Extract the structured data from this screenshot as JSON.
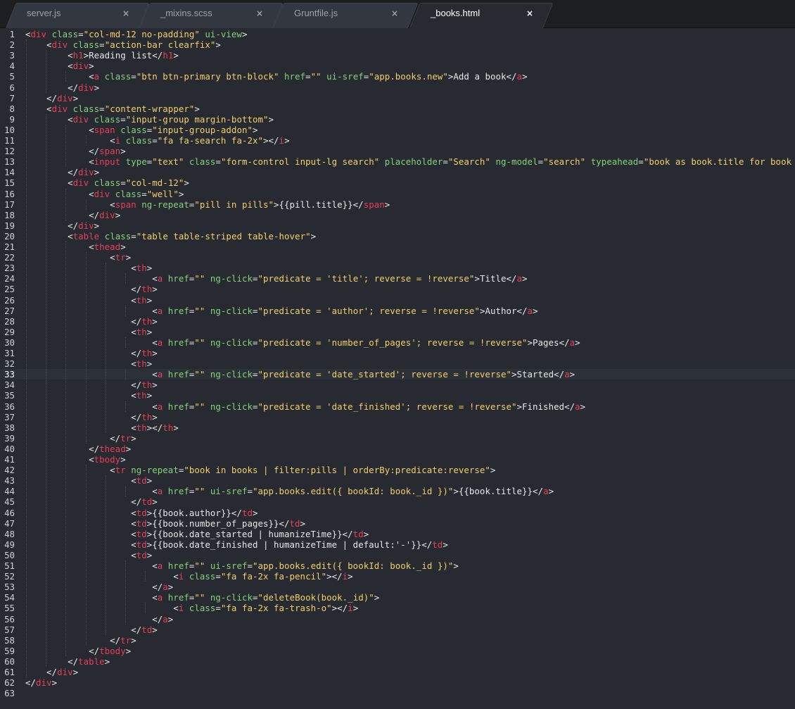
{
  "tabs": [
    {
      "label": "server.js",
      "active": false
    },
    {
      "label": "_mixins.scss",
      "active": false
    },
    {
      "label": "Gruntfile.js",
      "active": false
    },
    {
      "label": "_books.html",
      "active": true
    }
  ],
  "tab_close_glyph": "×",
  "editor": {
    "current_line": 33,
    "colors": {
      "tag": "#e83e5c",
      "attribute": "#84d27c",
      "string": "#f2d16b",
      "text": "#e8e8e8",
      "background": "#272a31"
    },
    "lines": [
      {
        "n": "1",
        "code": "<div class=\"col-md-12 no-padding\" ui-view>"
      },
      {
        "n": "2",
        "code": "    <div class=\"action-bar clearfix\">"
      },
      {
        "n": "3",
        "code": "        <h1>Reading list</h1>"
      },
      {
        "n": "4",
        "code": "        <div>"
      },
      {
        "n": "5",
        "code": "            <a class=\"btn btn-primary btn-block\" href=\"\" ui-sref=\"app.books.new\">Add a book</a>"
      },
      {
        "n": "6",
        "code": "        </div>"
      },
      {
        "n": "7",
        "code": "    </div>"
      },
      {
        "n": "8",
        "code": "    <div class=\"content-wrapper\">"
      },
      {
        "n": "9",
        "code": "        <div class=\"input-group margin-bottom\">"
      },
      {
        "n": "10",
        "code": "            <span class=\"input-group-addon\">"
      },
      {
        "n": "11",
        "code": "                <i class=\"fa fa-search fa-2x\"></i>"
      },
      {
        "n": "12",
        "code": "            </span>"
      },
      {
        "n": "13",
        "code": "            <input type=\"text\" class=\"form-control input-lg search\" placeholder=\"Search\" ng-model=\"search\" typeahead=\"book as book.title for book in books |"
      },
      {
        "n": "14",
        "code": "        </div>"
      },
      {
        "n": "15",
        "code": "        <div class=\"col-md-12\">"
      },
      {
        "n": "16",
        "code": "            <div class=\"well\">"
      },
      {
        "n": "17",
        "code": "                <span ng-repeat=\"pill in pills\">{{pill.title}}</span>"
      },
      {
        "n": "18",
        "code": "            </div>"
      },
      {
        "n": "19",
        "code": "        </div>"
      },
      {
        "n": "20",
        "code": "        <table class=\"table table-striped table-hover\">"
      },
      {
        "n": "21",
        "code": "            <thead>"
      },
      {
        "n": "22",
        "code": "                <tr>"
      },
      {
        "n": "23",
        "code": "                    <th>"
      },
      {
        "n": "24",
        "code": "                        <a href=\"\" ng-click=\"predicate = 'title'; reverse = !reverse\">Title</a>"
      },
      {
        "n": "25",
        "code": "                    </th>"
      },
      {
        "n": "26",
        "code": "                    <th>"
      },
      {
        "n": "27",
        "code": "                        <a href=\"\" ng-click=\"predicate = 'author'; reverse = !reverse\">Author</a>"
      },
      {
        "n": "28",
        "code": "                    </th>"
      },
      {
        "n": "29",
        "code": "                    <th>"
      },
      {
        "n": "30",
        "code": "                        <a href=\"\" ng-click=\"predicate = 'number_of_pages'; reverse = !reverse\">Pages</a>"
      },
      {
        "n": "31",
        "code": "                    </th>"
      },
      {
        "n": "32",
        "code": "                    <th>"
      },
      {
        "n": "33",
        "code": "                        <a href=\"\" ng-click=\"predicate = 'date_started'; reverse = !reverse\">Started</a>"
      },
      {
        "n": "34",
        "code": "                    </th>"
      },
      {
        "n": "35",
        "code": "                    <th>"
      },
      {
        "n": "36",
        "code": "                        <a href=\"\" ng-click=\"predicate = 'date_finished'; reverse = !reverse\">Finished</a>"
      },
      {
        "n": "37",
        "code": "                    </th>"
      },
      {
        "n": "38",
        "code": "                    <th></th>"
      },
      {
        "n": "39",
        "code": "                </tr>"
      },
      {
        "n": "40",
        "code": "            </thead>"
      },
      {
        "n": "41",
        "code": "            <tbody>"
      },
      {
        "n": "42",
        "code": "                <tr ng-repeat=\"book in books | filter:pills | orderBy:predicate:reverse\">"
      },
      {
        "n": "43",
        "code": "                    <td>"
      },
      {
        "n": "44",
        "code": "                        <a href=\"\" ui-sref=\"app.books.edit({ bookId: book._id })\">{{book.title}}</a>"
      },
      {
        "n": "45",
        "code": "                    </td>"
      },
      {
        "n": "46",
        "code": "                    <td>{{book.author}}</td>"
      },
      {
        "n": "47",
        "code": "                    <td>{{book.number_of_pages}}</td>"
      },
      {
        "n": "48",
        "code": "                    <td>{{book.date_started | humanizeTime}}</td>"
      },
      {
        "n": "49",
        "code": "                    <td>{{book.date_finished | humanizeTime | default:'-'}}</td>"
      },
      {
        "n": "50",
        "code": "                    <td>"
      },
      {
        "n": "51",
        "code": "                        <a href=\"\" ui-sref=\"app.books.edit({ bookId: book._id })\">"
      },
      {
        "n": "52",
        "code": "                            <i class=\"fa fa-2x fa-pencil\"></i>"
      },
      {
        "n": "53",
        "code": "                        </a>"
      },
      {
        "n": "54",
        "code": "                        <a href=\"\" ng-click=\"deleteBook(book._id)\">"
      },
      {
        "n": "55",
        "code": "                            <i class=\"fa fa-2x fa-trash-o\"></i>"
      },
      {
        "n": "56",
        "code": "                        </a>"
      },
      {
        "n": "57",
        "code": "                    </td>"
      },
      {
        "n": "58",
        "code": "                </tr>"
      },
      {
        "n": "59",
        "code": "            </tbody>"
      },
      {
        "n": "60",
        "code": "        </table>"
      },
      {
        "n": "61",
        "code": "    </div>"
      },
      {
        "n": "62",
        "code": "</div>"
      },
      {
        "n": "63",
        "code": ""
      }
    ]
  }
}
